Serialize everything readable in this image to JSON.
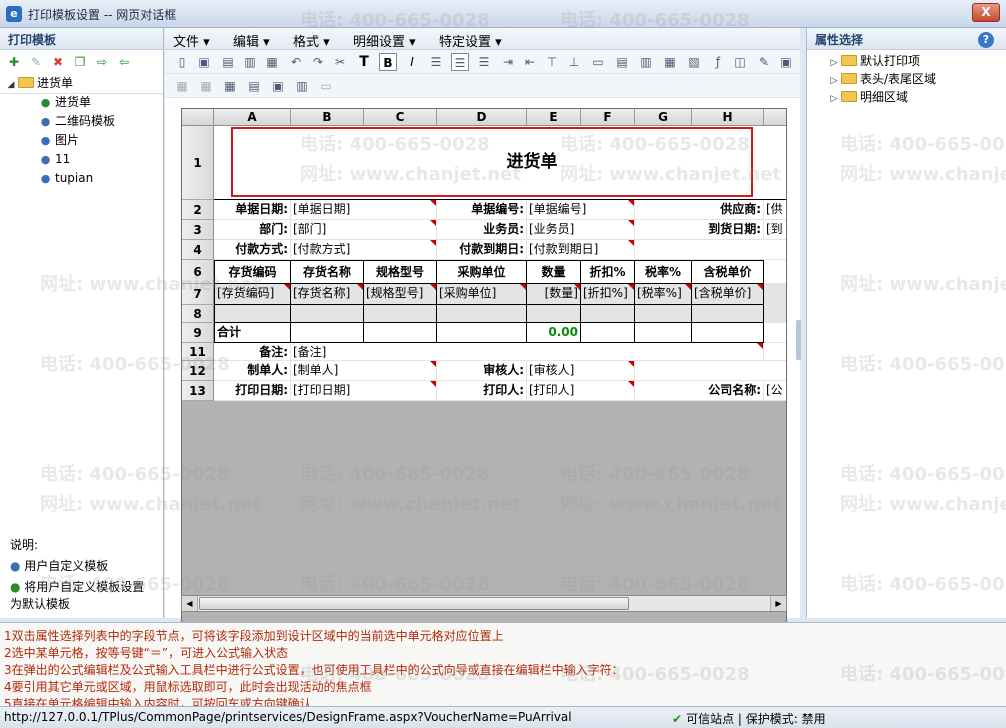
{
  "window": {
    "title": "打印模板设置 -- 网页对话框",
    "app_icon": "ie-icon",
    "close_label": "X"
  },
  "left": {
    "header": "打印模板",
    "toolbar_icons": [
      "new-icon",
      "edit-icon",
      "delete-icon",
      "copy-icon",
      "export-icon",
      "import-icon"
    ],
    "tree": {
      "root": "进货单",
      "children": [
        "进货单",
        "二维码模板",
        "图片",
        "11",
        "tupian"
      ]
    },
    "desc_title": "说明:",
    "desc_items": [
      "用户自定义模板",
      "将用户自定义模板设置为默认模板"
    ]
  },
  "menu": [
    {
      "label": "文件 ▾"
    },
    {
      "label": "编辑 ▾"
    },
    {
      "label": "格式 ▾"
    },
    {
      "label": "明细设置 ▾"
    },
    {
      "label": "特定设置 ▾"
    }
  ],
  "grid": {
    "columns": [
      "A",
      "B",
      "C",
      "D",
      "E",
      "F",
      "G",
      "H"
    ],
    "row_numbers": [
      "1",
      "2",
      "3",
      "4",
      "6",
      "7",
      "8",
      "9",
      "11",
      "12",
      "13"
    ],
    "title": "进货单",
    "r2": [
      "单据日期:",
      "[单据日期]",
      "单据编号:",
      "[单据编号]",
      "供应商:",
      "[供"
    ],
    "r3": [
      "部门:",
      "[部门]",
      "业务员:",
      "[业务员]",
      "到货日期:",
      "[到"
    ],
    "r4": [
      "付款方式:",
      "[付款方式]",
      "付款到期日:",
      "[付款到期日]"
    ],
    "r6": [
      "存货编码",
      "存货名称",
      "规格型号",
      "采购单位",
      "数量",
      "折扣%",
      "税率%",
      "含税单价"
    ],
    "r7": [
      "[存货编码]",
      "[存货名称]",
      "[规格型号]",
      "[采购单位]",
      "[数量]",
      "[折扣%]",
      "[税率%]",
      "[含税单价]"
    ],
    "r9": [
      "合计",
      "0.00"
    ],
    "r11": [
      "备注:",
      "[备注]"
    ],
    "r12": [
      "制单人:",
      "[制单人]",
      "审核人:",
      "[审核人]"
    ],
    "r13": [
      "打印日期:",
      "[打印日期]",
      "打印人:",
      "[打印人]",
      "公司名称:",
      "[公"
    ]
  },
  "right": {
    "header": "属性选择",
    "tree": [
      "默认打印项",
      "表头/表尾区域",
      "明细区域"
    ]
  },
  "notes": [
    "1双击属性选择列表中的字段节点，可将该字段添加到设计区域中的当前选中单元格对应位置上",
    "2选中某单元格，按等号键“＝”，可进入公式输入状态",
    "3在弹出的公式编辑栏及公式输入工具栏中进行公式设置，也可使用工具栏中的公式向导或直接在编辑栏中输入字符：",
    "4要引用其它单元或区域，用鼠标选取即可，此时会出现活动的焦点框",
    "5直接在单元格编辑中输入内容时，可按回车或方向键确认"
  ],
  "status": {
    "url": "http://127.0.0.1/TPlus/CommonPage/printservices/DesignFrame.aspx?VoucherName=PuArrival",
    "zone": "可信站点 | 保护模式: 禁用"
  },
  "watermark": {
    "phone": "电话: 400-665-0028",
    "site": "网址: www.chanjet.net"
  }
}
